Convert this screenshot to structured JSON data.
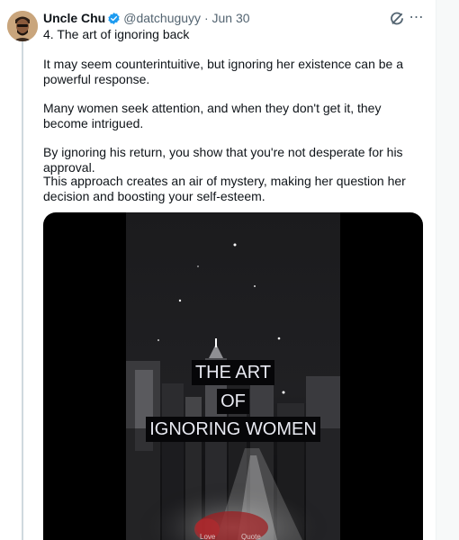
{
  "tweet": {
    "display_name": "Uncle Chu",
    "handle": "@datchuguyy",
    "separator": "·",
    "date": "Jun 30",
    "paragraphs": [
      "4. The art of ignoring back",
      "It may seem counterintuitive, but ignoring her existence can be a powerful response.",
      "Many women seek attention, and when they don't get it, they become intrigued.",
      "By ignoring his return, you show that you're not desperate for his approval.",
      "This approach creates an air of mystery, making her question her decision and boosting your self-esteem."
    ],
    "more_icon": "⋯"
  },
  "icons": {
    "verified": "verified-badge-icon",
    "grok": "grok-icon",
    "more": "more-icon"
  },
  "video": {
    "captions": [
      "THE ART",
      "OF",
      "IGNORING WOMEN"
    ],
    "bottom_labels": [
      "Love",
      "Quote"
    ]
  },
  "colors": {
    "verified": "#1d9bf0",
    "text": "#0f1419",
    "secondary": "#536471",
    "thread_line": "#cfd9de",
    "caption_text": "#e9eaf2"
  }
}
